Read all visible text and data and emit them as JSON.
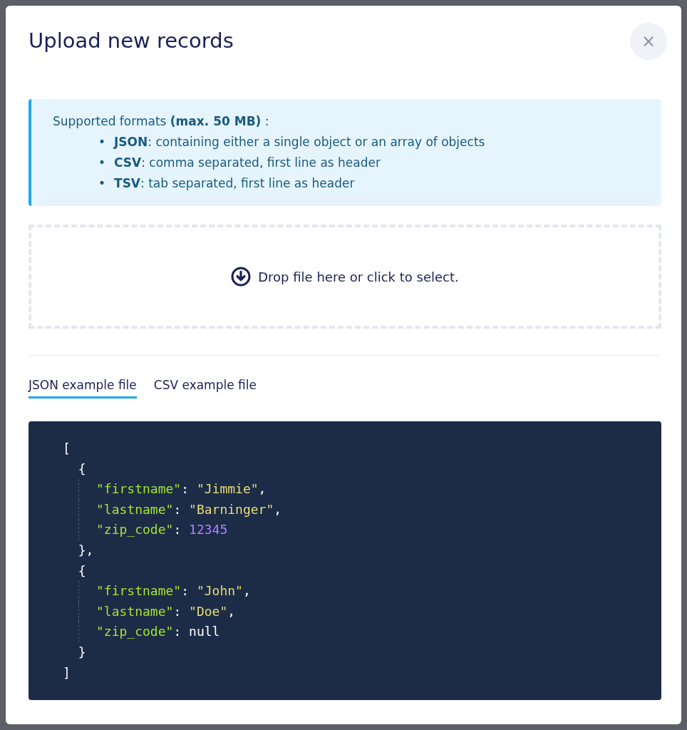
{
  "dialog": {
    "title": "Upload new records",
    "close": "×"
  },
  "info": {
    "intro": "Supported formats **(max. 50 MB)** :",
    "formats": [
      {
        "bullet": "•",
        "name": "JSON",
        "text": ": containing either a single object or an array of objects"
      },
      {
        "bullet": "•",
        "name": "CSV",
        "text": ": comma separated, first line as header"
      },
      {
        "bullet": "•",
        "name": "TSV",
        "text": ": tab separated, first line as header"
      }
    ]
  },
  "dropzone": {
    "label": "Drop file here or click to select."
  },
  "tabs": [
    {
      "label": "JSON example file",
      "selected": true
    },
    {
      "label": "CSV example file",
      "selected": false
    }
  ],
  "code": {
    "lines": [
      {
        "guide": false,
        "tokens": [
          {
            "kind": "punct",
            "text": "["
          }
        ]
      },
      {
        "guide": false,
        "tokens": [
          {
            "kind": "punct",
            "text": "  {"
          }
        ]
      },
      {
        "guide": true,
        "tokens": [
          {
            "kind": "key",
            "text": "\"firstname\""
          },
          {
            "kind": "punct",
            "text": ": "
          },
          {
            "kind": "string",
            "text": "\"Jimmie\""
          },
          {
            "kind": "punct",
            "text": ","
          }
        ]
      },
      {
        "guide": true,
        "tokens": [
          {
            "kind": "key",
            "text": "\"lastname\""
          },
          {
            "kind": "punct",
            "text": ": "
          },
          {
            "kind": "string",
            "text": "\"Barninger\""
          },
          {
            "kind": "punct",
            "text": ","
          }
        ]
      },
      {
        "guide": true,
        "tokens": [
          {
            "kind": "key",
            "text": "\"zip_code\""
          },
          {
            "kind": "punct",
            "text": ": "
          },
          {
            "kind": "number",
            "text": "12345"
          }
        ]
      },
      {
        "guide": false,
        "tokens": [
          {
            "kind": "punct",
            "text": "  },"
          }
        ]
      },
      {
        "guide": false,
        "tokens": [
          {
            "kind": "punct",
            "text": "  {"
          }
        ]
      },
      {
        "guide": true,
        "tokens": [
          {
            "kind": "key",
            "text": "\"firstname\""
          },
          {
            "kind": "punct",
            "text": ": "
          },
          {
            "kind": "string",
            "text": "\"John\""
          },
          {
            "kind": "punct",
            "text": ","
          }
        ]
      },
      {
        "guide": true,
        "tokens": [
          {
            "kind": "key",
            "text": "\"lastname\""
          },
          {
            "kind": "punct",
            "text": ": "
          },
          {
            "kind": "string",
            "text": "\"Doe\""
          },
          {
            "kind": "punct",
            "text": ","
          }
        ]
      },
      {
        "guide": true,
        "tokens": [
          {
            "kind": "key",
            "text": "\"zip_code\""
          },
          {
            "kind": "punct",
            "text": ": "
          },
          {
            "kind": "null",
            "text": "null"
          }
        ]
      },
      {
        "guide": false,
        "tokens": [
          {
            "kind": "punct",
            "text": "  }"
          }
        ]
      },
      {
        "guide": false,
        "tokens": [
          {
            "kind": "punct",
            "text": "]"
          }
        ]
      }
    ]
  }
}
